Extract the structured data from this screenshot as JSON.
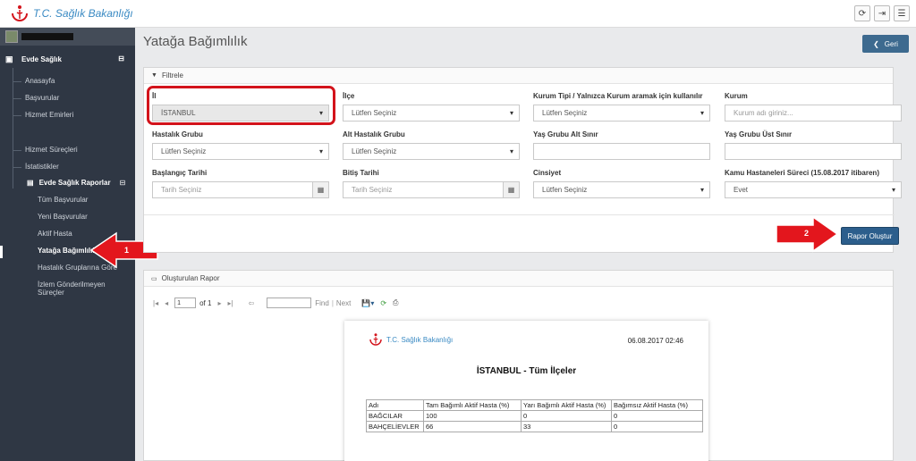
{
  "brand": {
    "name": "T.C. Sağlık Bakanlığı",
    "colors": {
      "accent": "#2c5e8c",
      "sidebar": "#2f3744",
      "highlight": "#d3131b"
    }
  },
  "header": {
    "buttons": [
      "refresh-icon",
      "logout-icon",
      "menu-icon"
    ]
  },
  "sidebar": {
    "section": "Evde Sağlık",
    "items": [
      {
        "label": "Anasayfa"
      },
      {
        "label": "Başvurular"
      },
      {
        "label": "Hizmet Emirleri"
      },
      {
        "label": "Hizmet Süreçleri"
      },
      {
        "label": "İstatistikler"
      }
    ],
    "group": {
      "label": "Evde Sağlık Raporlar",
      "items": [
        {
          "label": "Tüm Başvurular"
        },
        {
          "label": "Yeni Başvurular"
        },
        {
          "label": "Aktif Hasta"
        },
        {
          "label": "Yatağa Bağımlılık",
          "active": true
        },
        {
          "label": "Hastalık Gruplarına Göre"
        },
        {
          "label": "İzlem Gönderilmeyen",
          "label2": "Süreçler"
        }
      ]
    }
  },
  "page": {
    "title": "Yatağa Bağımlılık",
    "back_label": "Geri"
  },
  "filter": {
    "title": "Filtrele",
    "il": {
      "label": "İl",
      "value": "İSTANBUL"
    },
    "ilce": {
      "label": "İlçe",
      "value": "Lütfen Seçiniz"
    },
    "kurum_tipi": {
      "label": "Kurum Tipi / Yalnızca Kurum aramak için kullanılır",
      "value": "Lütfen Seçiniz"
    },
    "kurum": {
      "label": "Kurum",
      "placeholder": "Kurum adı giriniz..."
    },
    "hastalik_grubu": {
      "label": "Hastalık Grubu",
      "value": "Lütfen Seçiniz"
    },
    "alt_hastalik_grubu": {
      "label": "Alt Hastalık Grubu",
      "value": "Lütfen Seçiniz"
    },
    "yas_alt": {
      "label": "Yaş Grubu Alt Sınır",
      "value": ""
    },
    "yas_ust": {
      "label": "Yaş Grubu Üst Sınır",
      "value": ""
    },
    "baslangic": {
      "label": "Başlangıç Tarihi",
      "placeholder": "Tarih Seçiniz"
    },
    "bitis": {
      "label": "Bitiş Tarihi",
      "placeholder": "Tarih Seçiniz"
    },
    "cinsiyet": {
      "label": "Cinsiyet",
      "value": "Lütfen Seçiniz"
    },
    "kamu": {
      "label": "Kamu Hastaneleri Süreci",
      "label_bold": "(15.08.2017 itibaren)",
      "value": "Evet"
    },
    "submit_label": "Rapor Oluştur"
  },
  "annotations": {
    "step1": "1",
    "step2": "2"
  },
  "report": {
    "panel_title": "Oluşturulan Rapor",
    "toolbar": {
      "page": "1",
      "of": "of 1",
      "find": "Find",
      "next": "Next"
    },
    "logo_text": "T.C. Sağlık Bakanlığı",
    "date": "06.08.2017 02:46",
    "title": "İSTANBUL - Tüm İlçeler",
    "columns": [
      "Adı",
      "Tam Bağımlı Aktif Hasta (%)",
      "Yarı Bağımlı Aktif Hasta (%)",
      "Bağımsız Aktif Hasta (%)"
    ],
    "rows": [
      [
        "BAĞCILAR",
        "100",
        "0",
        "0"
      ],
      [
        "BAHÇELİEVLER",
        "66",
        "33",
        "0"
      ]
    ]
  }
}
